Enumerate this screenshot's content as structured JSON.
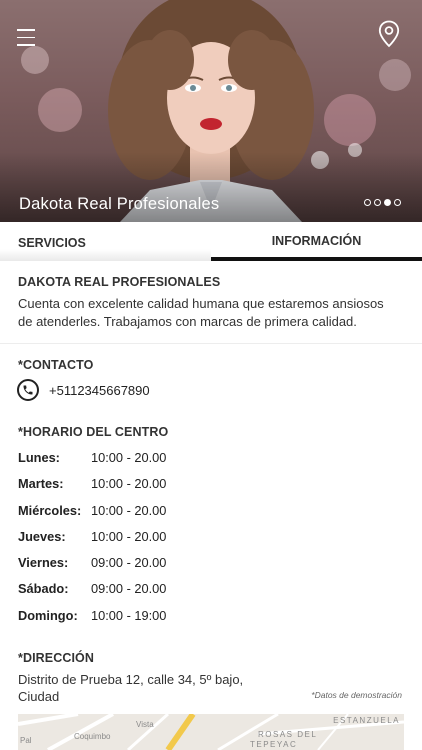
{
  "hero": {
    "title": "Dakota Real Profesionales",
    "slide_count": 4,
    "active_slide": 3
  },
  "tabs": [
    {
      "label": "SERVICIOS",
      "active": false
    },
    {
      "label": "INFORMACIÓN",
      "active": true
    }
  ],
  "about": {
    "title": "DAKOTA REAL PROFESIONALES",
    "line1": "Cuenta con excelente  calidad humana que estaremos ansiosos",
    "line2": "de atenderles. Trabajamos con marcas de primera calidad."
  },
  "contact": {
    "title": "*CONTACTO",
    "phone": "+5112345667890"
  },
  "schedule": {
    "title": "*HORARIO DEL CENTRO",
    "rows": [
      {
        "day": "Lunes:",
        "time": "10:00 - 20.00"
      },
      {
        "day": "Martes:",
        "time": "10:00 - 20.00"
      },
      {
        "day": "Miércoles:",
        "time": "10:00 - 20.00"
      },
      {
        "day": "Jueves:",
        "time": "10:00 - 20.00"
      },
      {
        "day": "Viernes:",
        "time": "09:00 - 20.00"
      },
      {
        "day": "Sábado:",
        "time": "09:00 - 20.00"
      },
      {
        "day": "Domingo:",
        "time": "10:00 - 19:00"
      }
    ]
  },
  "address": {
    "title": "*DIRECCIÓN",
    "line1": "Distrito de Prueba 12, calle 34, 5º bajo,",
    "line2": "Ciudad",
    "demo_note": "*Datos de demostración"
  },
  "map": {
    "labels": [
      "ESTANZUELA",
      "ROSAS DEL",
      "TEPEYAC",
      "Coquimbo",
      "Vista",
      "Pal"
    ]
  },
  "colors": {
    "accent": "#111111",
    "hero_overlay": "#5e4646",
    "map_road": "#f2c94c"
  },
  "icons": {
    "menu": "hamburger-icon",
    "location": "map-pin-icon",
    "phone": "phone-icon"
  }
}
